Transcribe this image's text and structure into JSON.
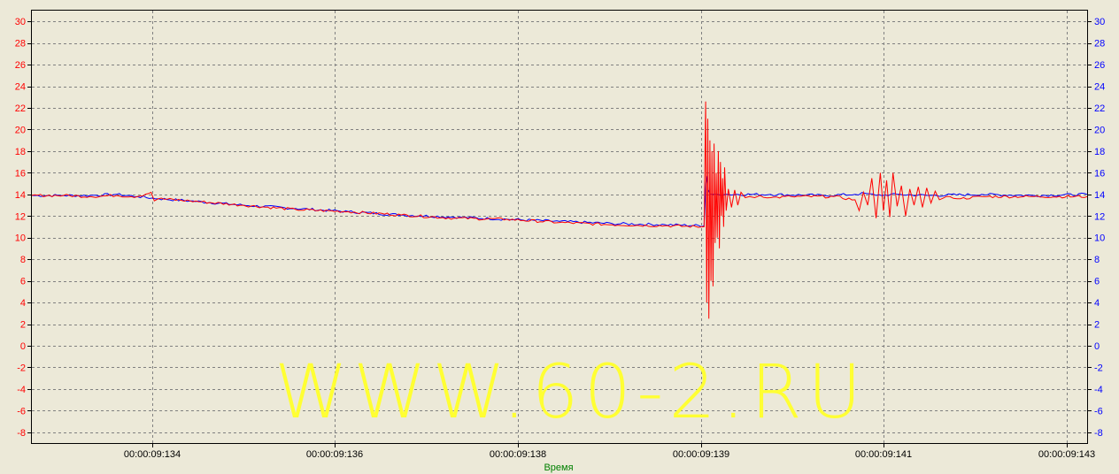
{
  "chart_data": {
    "type": "line",
    "xlabel": "Время",
    "x_ticks": [
      "00:00:09:134",
      "00:00:09:136",
      "00:00:09:138",
      "00:00:09:139",
      "00:00:09:141",
      "00:00:09:143"
    ],
    "ylim": [
      -9,
      31
    ],
    "left_axis_ticks": [
      -8,
      -6,
      -4,
      -2,
      0,
      2,
      4,
      6,
      8,
      10,
      12,
      14,
      16,
      18,
      20,
      22,
      24,
      26,
      28,
      30
    ],
    "right_axis_ticks": [
      -8,
      -6,
      -4,
      -2,
      0,
      2,
      4,
      6,
      8,
      10,
      12,
      14,
      16,
      18,
      20,
      22,
      24,
      26,
      28,
      30
    ],
    "grid": true,
    "xlim": [
      0,
      1
    ],
    "series": [
      {
        "color": "#0000ff",
        "axis": "right",
        "x": [
          0.0,
          0.03,
          0.055,
          0.08,
          0.1,
          0.12,
          0.15,
          0.2,
          0.25,
          0.3,
          0.35,
          0.4,
          0.45,
          0.5,
          0.55,
          0.6,
          0.637,
          0.639,
          0.641,
          0.643,
          0.65,
          0.66,
          0.7,
          0.75,
          0.78,
          0.79,
          0.8,
          0.82,
          0.85,
          0.9,
          0.95,
          1.0
        ],
        "values": [
          13.9,
          13.9,
          13.9,
          14.0,
          13.8,
          13.6,
          13.4,
          13.0,
          12.7,
          12.4,
          12.1,
          11.9,
          11.7,
          11.5,
          11.3,
          11.2,
          11.1,
          15.7,
          14.4,
          14.0,
          14.0,
          14.0,
          14.0,
          13.9,
          14.0,
          14.1,
          13.9,
          14.0,
          13.9,
          14.0,
          13.9,
          14.0
        ]
      },
      {
        "color": "#ff0000",
        "axis": "left",
        "x": [
          0.0,
          0.03,
          0.055,
          0.08,
          0.1,
          0.113,
          0.116,
          0.12,
          0.15,
          0.2,
          0.25,
          0.3,
          0.35,
          0.4,
          0.45,
          0.5,
          0.55,
          0.6,
          0.637,
          0.6385,
          0.6395,
          0.6405,
          0.6415,
          0.6425,
          0.6435,
          0.6445,
          0.6455,
          0.6465,
          0.6475,
          0.6485,
          0.6495,
          0.6505,
          0.6515,
          0.6525,
          0.6535,
          0.6545,
          0.6555,
          0.6565,
          0.658,
          0.66,
          0.663,
          0.666,
          0.669,
          0.672,
          0.676,
          0.68,
          0.685,
          0.69,
          0.7,
          0.72,
          0.76,
          0.78,
          0.784,
          0.788,
          0.792,
          0.796,
          0.8,
          0.804,
          0.807,
          0.81,
          0.813,
          0.816,
          0.82,
          0.824,
          0.828,
          0.832,
          0.836,
          0.84,
          0.844,
          0.848,
          0.852,
          0.856,
          0.86,
          0.87,
          0.88,
          0.9,
          0.95,
          1.0
        ],
        "values": [
          13.9,
          13.9,
          13.8,
          13.9,
          13.8,
          14.2,
          13.4,
          13.6,
          13.4,
          13.0,
          12.6,
          12.4,
          12.1,
          11.8,
          11.7,
          11.4,
          11.2,
          11.1,
          11.0,
          22.6,
          4.0,
          21.0,
          2.5,
          19.0,
          6.0,
          18.0,
          5.5,
          18.7,
          9.5,
          16.0,
          10.0,
          18.0,
          9.0,
          17.0,
          12.0,
          15.5,
          11.0,
          16.5,
          12.5,
          14.5,
          12.8,
          14.4,
          13.0,
          14.2,
          13.7,
          13.8,
          13.7,
          13.9,
          13.7,
          13.8,
          13.8,
          13.5,
          12.5,
          14.2,
          13.0,
          15.5,
          11.8,
          16.0,
          12.5,
          15.3,
          11.9,
          16.0,
          12.9,
          14.8,
          12.0,
          14.5,
          13.0,
          14.7,
          12.8,
          14.6,
          13.2,
          14.3,
          13.5,
          13.8,
          13.6,
          13.8,
          13.8,
          13.8
        ]
      }
    ]
  },
  "watermark": "WWW.60-2.RU",
  "colors": {
    "background": "#ece9d8",
    "left_axis": "#ff0000",
    "right_axis": "#0000ff",
    "xlabel": "#008000",
    "watermark": "#ffff33"
  }
}
